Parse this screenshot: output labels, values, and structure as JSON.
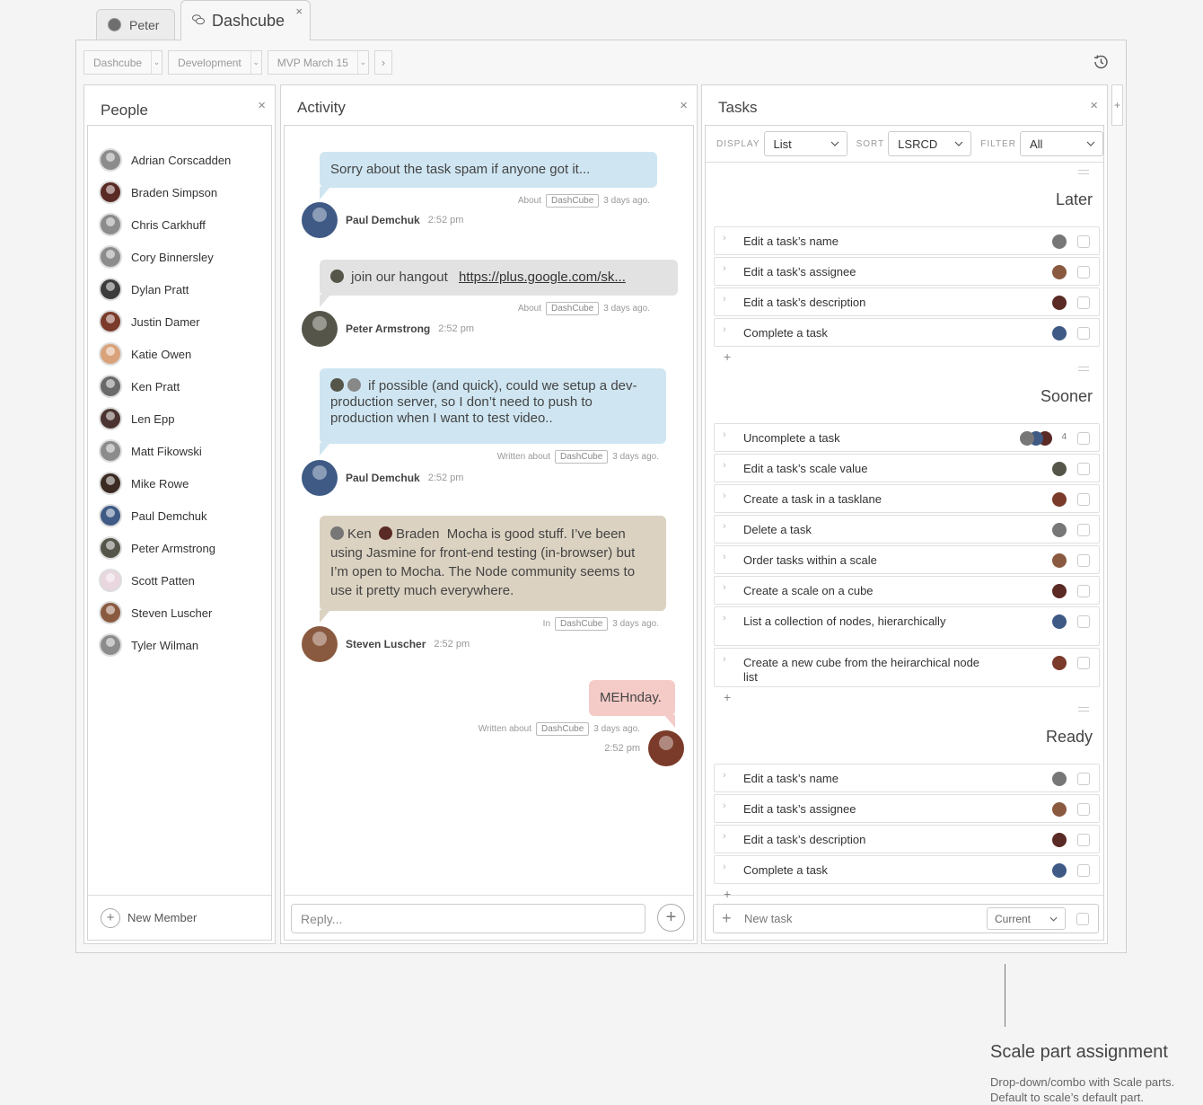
{
  "tabs": [
    {
      "label": "Peter",
      "closable": false
    },
    {
      "label": "Dashcube",
      "closable": true,
      "close_glyph": "×"
    }
  ],
  "breadcrumbs": [
    "Dashcube",
    "Development",
    "MVP March 15"
  ],
  "breadcrumb_next": "›",
  "panels": {
    "people": {
      "title": "People",
      "close": "×",
      "members": [
        {
          "name": "Adrian Corscadden",
          "color": "#8c8c8c"
        },
        {
          "name": "Braden Simpson",
          "color": "#5a2a24"
        },
        {
          "name": "Chris Carkhuff",
          "color": "#8c8c8c"
        },
        {
          "name": "Cory Binnersley",
          "color": "#8c8c8c"
        },
        {
          "name": "Dylan Pratt",
          "color": "#3c3c3c"
        },
        {
          "name": "Justin Damer",
          "color": "#7a3b2a"
        },
        {
          "name": "Katie Owen",
          "color": "#d9a27a"
        },
        {
          "name": "Ken Pratt",
          "color": "#6a6a6a"
        },
        {
          "name": "Len Epp",
          "color": "#4a3330"
        },
        {
          "name": "Matt Fikowski",
          "color": "#8c8c8c"
        },
        {
          "name": "Mike Rowe",
          "color": "#3b2b22"
        },
        {
          "name": "Paul Demchuk",
          "color": "#3e5a85"
        },
        {
          "name": "Peter Armstrong",
          "color": "#55554a"
        },
        {
          "name": "Scott Patten",
          "color": "#e9d6df"
        },
        {
          "name": "Steven Luscher",
          "color": "#8a5a40"
        },
        {
          "name": "Tyler Wilman",
          "color": "#8c8c8c"
        }
      ],
      "footer_label": "New Member"
    },
    "activity": {
      "title": "Activity",
      "close": "×",
      "messages": [
        {
          "text": "Sorry about the task spam if anyone got it...",
          "meta_prefix": "About",
          "tag": "DashCube",
          "ago": "3 days ago.",
          "author": "Paul Demchuk",
          "time": "2:52 pm",
          "avatar_color": "#3e5a85"
        },
        {
          "mention_text": "join our hangout",
          "link": "https://plus.google.com/sk...",
          "meta_prefix": "About",
          "tag": "DashCube",
          "ago": "3 days ago.",
          "author": "Peter Armstrong",
          "time": "2:52 pm",
          "avatar_color": "#55554a"
        },
        {
          "text": "if possible (and quick), could we setup a dev-production server, so I don’t need to push to production when I want to test video..",
          "meta_prefix": "Written about",
          "tag": "DashCube",
          "ago": "3 days ago.",
          "author": "Paul Demchuk",
          "time": "2:52 pm",
          "avatar_color": "#3e5a85"
        },
        {
          "mention_1": "Ken",
          "mention_2": "Braden",
          "text": "Mocha is good stuff. I’ve been using Jasmine for front-end testing (in-browser) but I’m open to Mocha. The Node community seems to use it pretty much everywhere.",
          "meta_prefix": "In",
          "tag": "DashCube",
          "ago": "3 days ago.",
          "author": "Steven Luscher",
          "time": "2:52 pm",
          "avatar_color": "#8a5a40"
        },
        {
          "text": "MEHnday.",
          "meta_prefix": "Written about",
          "tag": "DashCube",
          "ago": "3 days ago.",
          "time": "2:52 pm",
          "avatar_color": "#7a3b2a"
        }
      ],
      "reply_placeholder": "Reply..."
    },
    "tasks": {
      "title": "Tasks",
      "close": "×",
      "toolbar": {
        "display_label": "DISPLAY",
        "display_value": "List",
        "sort_label": "SORT",
        "sort_value": "LSRCD",
        "filter_label": "FILTER",
        "filter_value": "All"
      },
      "lanes": [
        {
          "title": "Later",
          "tasks": [
            {
              "name": "Edit a task’s name",
              "avatar_color": "#777"
            },
            {
              "name": "Edit a task’s assignee",
              "avatar_color": "#8a5a40"
            },
            {
              "name": "Edit a task’s description",
              "avatar_color": "#5a2a24"
            },
            {
              "name": "Complete a task",
              "avatar_color": "#3e5a85"
            }
          ]
        },
        {
          "title": "Sooner",
          "tasks": [
            {
              "name": "Uncomplete a task",
              "avatar_color": "#5a2a24",
              "count": "4"
            },
            {
              "name": "Edit a task’s scale value",
              "avatar_color": "#55554a"
            },
            {
              "name": "Create a task in a tasklane",
              "avatar_color": "#7a3b2a"
            },
            {
              "name": "Delete a task",
              "avatar_color": "#777"
            },
            {
              "name": "Order tasks within a scale",
              "avatar_color": "#8a5a40"
            },
            {
              "name": "Create a scale on a cube",
              "avatar_color": "#5a2a24"
            },
            {
              "name": "List a collection of nodes, hierarchically",
              "avatar_color": "#3e5a85"
            },
            {
              "name": "Create a new cube from the heirarchical node list",
              "avatar_color": "#7a3b2a"
            }
          ]
        },
        {
          "title": "Ready",
          "tasks": [
            {
              "name": "Edit a task’s name",
              "avatar_color": "#777"
            },
            {
              "name": "Edit a task’s assignee",
              "avatar_color": "#8a5a40"
            },
            {
              "name": "Edit a task’s description",
              "avatar_color": "#5a2a24"
            },
            {
              "name": "Complete a task",
              "avatar_color": "#3e5a85"
            }
          ]
        }
      ],
      "lane_add": "+",
      "new_task_placeholder": "New task",
      "scale_value": "Current"
    }
  },
  "add_panel": "+",
  "callout": {
    "title": "Scale part assignment",
    "description": "Drop-down/combo with Scale parts. Default to scale’s default part."
  }
}
